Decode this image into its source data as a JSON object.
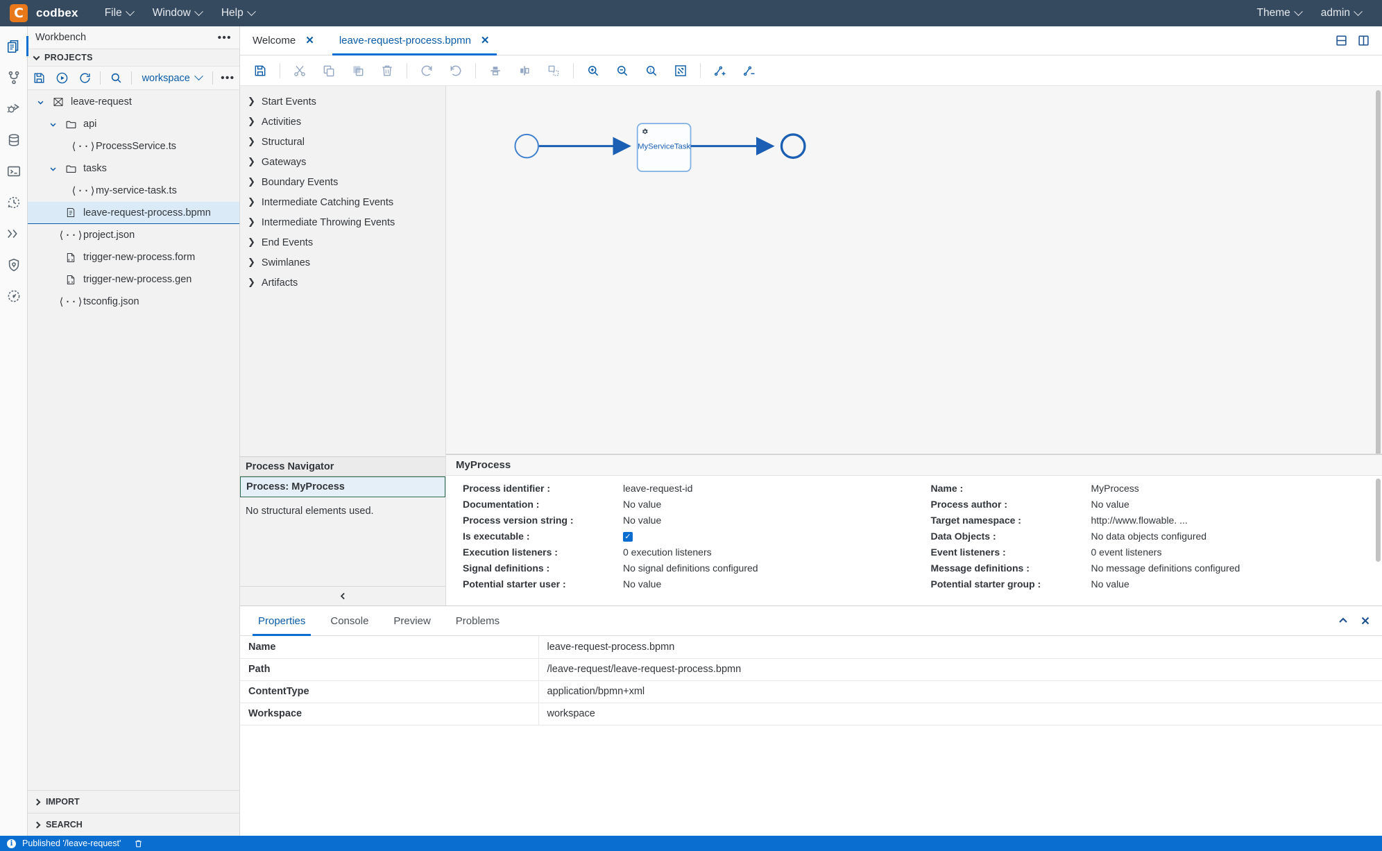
{
  "menubar": {
    "brand": "codbex",
    "logo_letter": "C",
    "items": [
      {
        "label": "File",
        "icon": "chevron-down-icon"
      },
      {
        "label": "Window",
        "icon": "chevron-down-icon"
      },
      {
        "label": "Help",
        "icon": "chevron-down-icon"
      }
    ],
    "right_items": [
      {
        "label": "Theme",
        "icon": "chevron-down-icon"
      },
      {
        "label": "admin",
        "icon": "chevron-down-icon"
      }
    ],
    "colors": {
      "bg": "#354a5f",
      "logo_bg": "#e8781a"
    }
  },
  "activitybar": {
    "items": [
      {
        "name": "explorer-icon",
        "active": true
      },
      {
        "name": "git-branch-icon",
        "active": false
      },
      {
        "name": "debug-icon",
        "active": false
      },
      {
        "name": "database-icon",
        "active": false
      },
      {
        "name": "terminal-icon",
        "active": false
      },
      {
        "name": "history-icon",
        "active": false
      },
      {
        "name": "jobs-icon",
        "active": false
      },
      {
        "name": "security-icon",
        "active": false
      },
      {
        "name": "performance-icon",
        "active": false
      }
    ]
  },
  "explorer": {
    "title": "Workbench",
    "menu_icon": "ellipsis-icon",
    "projects_section": {
      "label": "PROJECTS",
      "expanded": true
    },
    "toolbar": {
      "buttons": [
        {
          "name": "save-all-button",
          "title": "Save"
        },
        {
          "name": "run-button",
          "title": "Run"
        },
        {
          "name": "refresh-button",
          "title": "Refresh"
        },
        {
          "name": "search-button",
          "title": "Search"
        }
      ],
      "workspace_select": "workspace",
      "more_icon": "ellipsis-icon"
    },
    "tree": [
      {
        "label": "leave-request",
        "icon": "project-icon",
        "depth": 0,
        "twisty": "down",
        "selected": false
      },
      {
        "label": "api",
        "icon": "folder-icon",
        "depth": 1,
        "twisty": "down",
        "selected": false
      },
      {
        "label": "ProcessService.ts",
        "icon": "code-file-icon",
        "depth": 2,
        "twisty": "none",
        "selected": false
      },
      {
        "label": "tasks",
        "icon": "folder-icon",
        "depth": 1,
        "twisty": "down",
        "selected": false
      },
      {
        "label": "my-service-task.ts",
        "icon": "code-file-icon",
        "depth": 2,
        "twisty": "none",
        "selected": false
      },
      {
        "label": "leave-request-process.bpmn",
        "icon": "bpmn-file-icon",
        "depth": 1,
        "twisty": "none",
        "selected": true
      },
      {
        "label": "project.json",
        "icon": "code-file-icon",
        "depth": 1,
        "twisty": "none",
        "selected": false
      },
      {
        "label": "trigger-new-process.form",
        "icon": "form-file-icon",
        "depth": 1,
        "twisty": "none",
        "selected": false
      },
      {
        "label": "trigger-new-process.gen",
        "icon": "form-file-icon",
        "depth": 1,
        "twisty": "none",
        "selected": false
      },
      {
        "label": "tsconfig.json",
        "icon": "code-file-icon",
        "depth": 1,
        "twisty": "none",
        "selected": false
      }
    ],
    "footer_sections": [
      {
        "label": "IMPORT",
        "expanded": false
      },
      {
        "label": "SEARCH",
        "expanded": false
      }
    ]
  },
  "editor": {
    "tabs": [
      {
        "label": "Welcome",
        "active": false,
        "close_icon": "close-icon"
      },
      {
        "label": "leave-request-process.bpmn",
        "active": true,
        "close_icon": "close-icon"
      }
    ],
    "layout_buttons": [
      {
        "name": "split-horizontal-icon"
      },
      {
        "name": "split-vertical-icon"
      }
    ],
    "toolbar": [
      {
        "name": "save-icon",
        "enabled": true
      },
      {
        "name": "cut-icon",
        "enabled": false
      },
      {
        "name": "copy-icon",
        "enabled": false
      },
      {
        "name": "paste-icon",
        "enabled": false
      },
      {
        "name": "delete-icon",
        "enabled": false
      },
      {
        "name": "redo-icon",
        "enabled": false
      },
      {
        "name": "undo-icon",
        "enabled": false
      },
      {
        "name": "align-middle-icon",
        "enabled": false
      },
      {
        "name": "align-center-icon",
        "enabled": false
      },
      {
        "name": "resize-icon",
        "enabled": false
      },
      {
        "name": "zoom-in-icon",
        "enabled": true
      },
      {
        "name": "zoom-out-icon",
        "enabled": true
      },
      {
        "name": "zoom-actual-icon",
        "enabled": true
      },
      {
        "name": "zoom-fit-icon",
        "enabled": true
      },
      {
        "name": "add-bendpoint-icon",
        "enabled": true
      },
      {
        "name": "remove-bendpoint-icon",
        "enabled": true
      }
    ]
  },
  "palette": {
    "groups": [
      {
        "label": "Start Events",
        "expanded": false
      },
      {
        "label": "Activities",
        "expanded": false
      },
      {
        "label": "Structural",
        "expanded": false
      },
      {
        "label": "Gateways",
        "expanded": false
      },
      {
        "label": "Boundary Events",
        "expanded": false
      },
      {
        "label": "Intermediate Catching Events",
        "expanded": false
      },
      {
        "label": "Intermediate Throwing Events",
        "expanded": false
      },
      {
        "label": "End Events",
        "expanded": false
      },
      {
        "label": "Swimlanes",
        "expanded": false
      },
      {
        "label": "Artifacts",
        "expanded": false
      }
    ]
  },
  "process_navigator": {
    "title": "Process Navigator",
    "selected": "Process: MyProcess",
    "empty_message": "No structural elements used.",
    "collapse_icon": "chevron-left-icon"
  },
  "diagram": {
    "nodes": [
      {
        "type": "start-event",
        "label": ""
      },
      {
        "type": "service-task",
        "label": "MyServiceTask",
        "icon": "gear-icon"
      },
      {
        "type": "end-event",
        "label": ""
      }
    ],
    "accent_color": "#1a5fb4"
  },
  "properties_panel": {
    "title": "MyProcess",
    "left_column": [
      {
        "label": "Process identifier :",
        "value": "leave-request-id",
        "type": "text"
      },
      {
        "label": "Documentation :",
        "value": "No value",
        "type": "text"
      },
      {
        "label": "Process version string :",
        "value": "No value",
        "type": "text"
      },
      {
        "label": "Is executable :",
        "value": "checked",
        "type": "checkbox"
      },
      {
        "label": "Execution listeners :",
        "value": "0 execution listeners",
        "type": "text"
      },
      {
        "label": "Signal definitions :",
        "value": "No signal definitions configured",
        "type": "text"
      },
      {
        "label": "Potential starter user :",
        "value": "No value",
        "type": "text"
      }
    ],
    "right_column": [
      {
        "label": "Name :",
        "value": "MyProcess",
        "type": "text"
      },
      {
        "label": "Process author :",
        "value": "No value",
        "type": "text"
      },
      {
        "label": "Target namespace :",
        "value": "http://www.flowable. ...",
        "type": "text"
      },
      {
        "label": "Data Objects :",
        "value": "No data objects configured",
        "type": "text"
      },
      {
        "label": "Event listeners :",
        "value": "0 event listeners",
        "type": "text"
      },
      {
        "label": "Message definitions :",
        "value": "No message definitions configured",
        "type": "text"
      },
      {
        "label": "Potential starter group :",
        "value": "No value",
        "type": "text"
      }
    ]
  },
  "bottom_panel": {
    "tabs": [
      {
        "label": "Properties",
        "active": true
      },
      {
        "label": "Console",
        "active": false
      },
      {
        "label": "Preview",
        "active": false
      },
      {
        "label": "Problems",
        "active": false
      }
    ],
    "controls": [
      {
        "name": "collapse-panel-icon"
      },
      {
        "name": "close-panel-icon"
      }
    ],
    "rows": [
      {
        "key": "Name",
        "value": "leave-request-process.bpmn"
      },
      {
        "key": "Path",
        "value": "/leave-request/leave-request-process.bpmn"
      },
      {
        "key": "ContentType",
        "value": "application/bpmn+xml"
      },
      {
        "key": "Workspace",
        "value": "workspace"
      }
    ]
  },
  "statusbar": {
    "icon": "info-icon",
    "message": "Published '/leave-request'",
    "action_icon": "trash-icon",
    "bg": "#0a6ed1"
  }
}
